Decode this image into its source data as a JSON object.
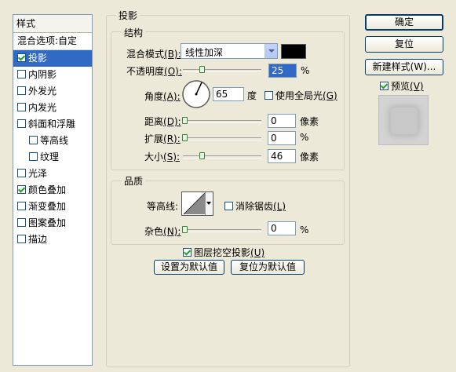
{
  "left_panel": {
    "header": "样式",
    "blend_options": "混合选项:自定",
    "items": [
      {
        "label": "投影",
        "checked": true,
        "selected": true
      },
      {
        "label": "内阴影",
        "checked": false
      },
      {
        "label": "外发光",
        "checked": false
      },
      {
        "label": "内发光",
        "checked": false
      },
      {
        "label": "斜面和浮雕",
        "checked": false
      },
      {
        "label": "等高线",
        "checked": false
      },
      {
        "label": "纹理",
        "checked": false
      },
      {
        "label": "光泽",
        "checked": false
      },
      {
        "label": "颜色叠加",
        "checked": true
      },
      {
        "label": "渐变叠加",
        "checked": false
      },
      {
        "label": "图案叠加",
        "checked": false
      },
      {
        "label": "描边",
        "checked": false
      }
    ]
  },
  "shadow": {
    "title": "投影",
    "structure_title": "结构",
    "blend_mode_label": "混合模式",
    "blend_mode_key": "(B):",
    "blend_mode_value": "线性加深",
    "color_swatch": "#000000",
    "opacity_label": "不透明度",
    "opacity_key": "(O):",
    "opacity_value": "25",
    "opacity_unit": "%",
    "angle_label": "角度",
    "angle_key": "(A):",
    "angle_value": "65",
    "angle_unit": "度",
    "global_light_label": "使用全局光",
    "global_light_key": "(G)",
    "distance_label": "距离",
    "distance_key": "(D):",
    "distance_value": "0",
    "distance_unit": "像素",
    "spread_label": "扩展",
    "spread_key": "(R):",
    "spread_value": "0",
    "spread_unit": "%",
    "size_label": "大小",
    "size_key": "(S):",
    "size_value": "46",
    "size_unit": "像素",
    "quality_title": "品质",
    "contour_label": "等高线:",
    "antialias_label": "消除锯齿",
    "antialias_key": "(L)",
    "noise_label": "杂色",
    "noise_key": "(N):",
    "noise_value": "0",
    "noise_unit": "%",
    "knockout_label": "图层挖空投影",
    "knockout_key": "(U)",
    "set_default": "设置为默认值",
    "reset_default": "复位为默认值"
  },
  "right_panel": {
    "ok": "确定",
    "reset": "复位",
    "new_style": "新建样式(W)...",
    "preview_label": "预览",
    "preview_key": "(V)"
  }
}
